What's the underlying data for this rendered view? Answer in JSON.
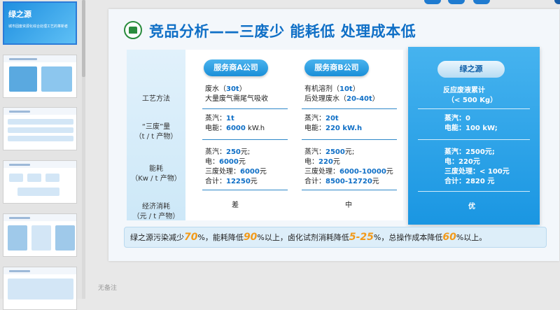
{
  "thumbnails": {
    "first_title": "绿之源",
    "first_subtitle": "城市固废资源化综合处理工艺的革新者"
  },
  "slide": {
    "title": "竞品分析——三废少 能耗低 处理成本低",
    "row_labels": [
      "工艺方法",
      "“三废”量\n（t / t 产物）",
      "能耗\n（Kw / t 产物）",
      "经济消耗\n（元 / t 产物）"
    ],
    "provider_a": {
      "header": "服务商A公司",
      "method_1": "废水（30t）",
      "method_2": "大量废气需尾气吸收",
      "waste_1": "蒸汽：1t",
      "waste_2": "电能：6000 kW.h",
      "energy_1": "蒸汽：250元;",
      "energy_2": "电：6000元",
      "energy_3": "三废处理：6000元",
      "energy_4": "合计：12250元",
      "cost": "差"
    },
    "provider_b": {
      "header": "服务商B公司",
      "method_1": "有机溶剂（10t）",
      "method_2": "后处理废水（20-40t）",
      "waste_1": "蒸汽：20t",
      "waste_2": "电能：220 kW.h",
      "energy_1": "蒸汽：2500元;",
      "energy_2": "电：220元",
      "energy_3": "三废处理：6000-10000元",
      "energy_4": "合计：8500-12720元",
      "cost": "中"
    },
    "green": {
      "header": "绿之源",
      "method_1": "反应废液累计",
      "method_2": "（< 500 Kg）",
      "waste_1": "蒸汽：0",
      "waste_2": "电能：100 kW;",
      "energy_1": "蒸汽：2500元;",
      "energy_2": "电：220元",
      "energy_3": "三废处理：< 100元",
      "energy_4": "合计：2820 元",
      "cost": "优"
    },
    "summary": {
      "p1": "绿之源污染减少",
      "n1": "70",
      "p2": "%，能耗降低",
      "n2": "90",
      "p3": "%以上，卤化试剂消耗降低",
      "n3": "5-25",
      "p4": "%，总操作成本降低",
      "n4": "60",
      "p5": "%以上。"
    }
  },
  "notes": "无备注"
}
